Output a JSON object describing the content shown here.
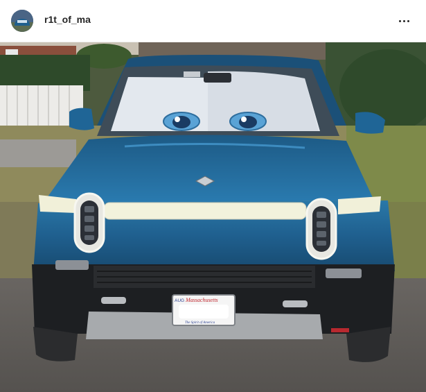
{
  "post": {
    "username": "r1t_of_ma",
    "more_icon": "more-horizontal-icon",
    "avatar_icon": "profile-avatar"
  },
  "photo": {
    "description_icon": "rivian-truck-photo",
    "plate_state": "Massachusetts",
    "plate_month": "AUG",
    "plate_slogan": "The Spirit of America"
  },
  "colors": {
    "truck_blue": "#1f5f8e",
    "background_white": "#ffffff",
    "text_dark": "#262626"
  }
}
